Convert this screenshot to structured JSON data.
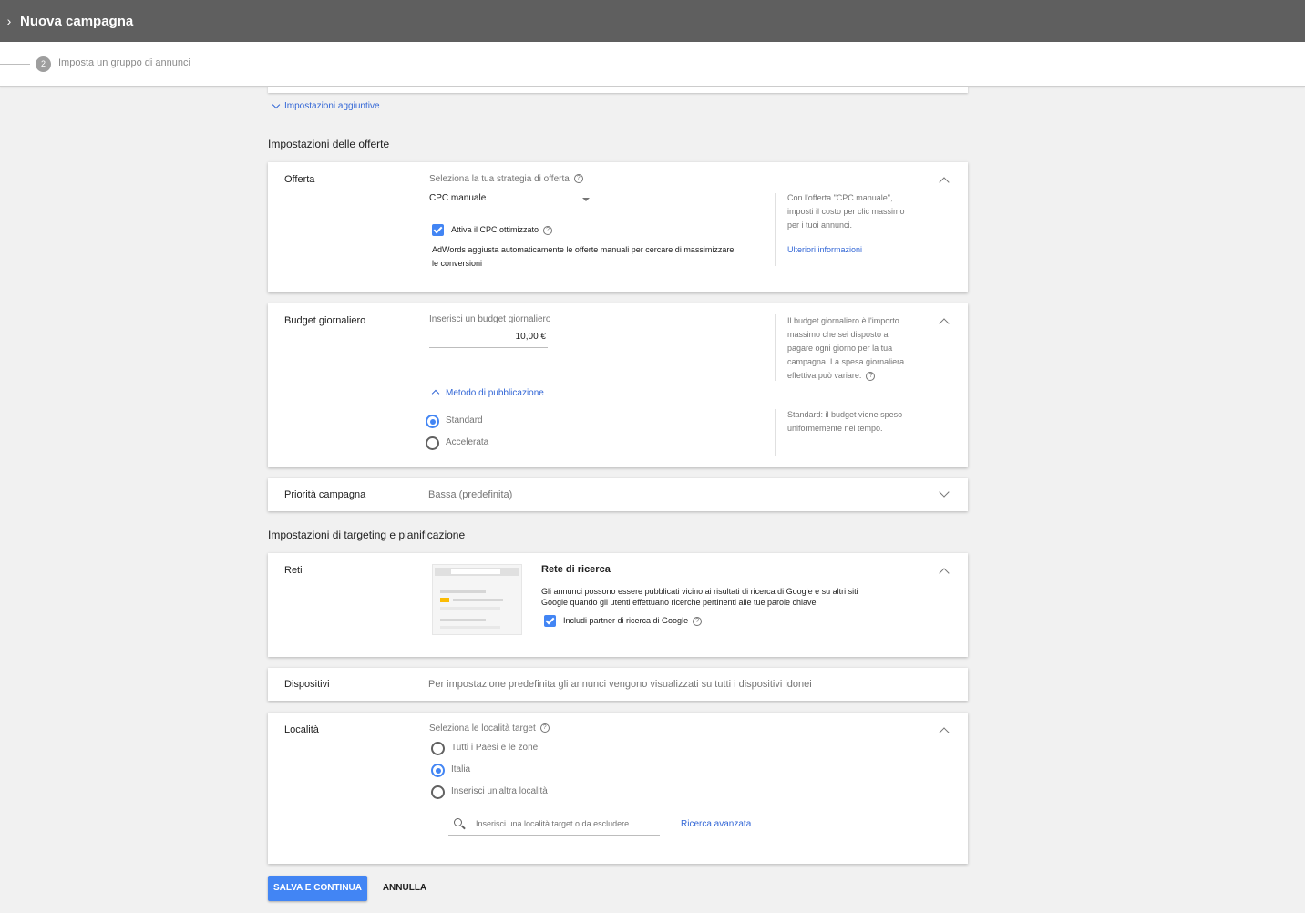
{
  "header": {
    "title": "Nuova campagna"
  },
  "stepper": {
    "step_number": "2",
    "step_label": "Imposta un gruppo di annunci"
  },
  "additional_settings_link": "Impostazioni aggiuntive",
  "bidding_section": {
    "title": "Impostazioni delle offerte"
  },
  "offer_card": {
    "label": "Offerta",
    "strategy_label": "Seleziona la tua strategia di offerta",
    "strategy_value": "CPC manuale",
    "ecpc_label": "Attiva il CPC ottimizzato",
    "ecpc_checked": true,
    "ecpc_description_1": "AdWords aggiusta automaticamente le offerte manuali per cercare di massimizzare",
    "ecpc_description_2": "le conversioni",
    "help_1": "Con l'offerta \"CPC manuale\",",
    "help_2": "imposti il costo per clic massimo",
    "help_3": "per i tuoi annunci.",
    "learn_more": "Ulteriori informazioni"
  },
  "budget_card": {
    "label": "Budget giornaliero",
    "input_label": "Inserisci un budget giornaliero",
    "value": "10,00 €",
    "delivery_link": "Metodo di pubblicazione",
    "options": [
      "Standard",
      "Accelerata"
    ],
    "selected": "Standard",
    "help_1": "Il budget giornaliero è l'importo",
    "help_2": "massimo che sei disposto a",
    "help_3": "pagare ogni giorno per la tua",
    "help_4": "campagna. La spesa giornaliera",
    "help_5": "effettiva può variare.",
    "standard_help_1": "Standard: il budget viene speso",
    "standard_help_2": "uniformemente nel tempo."
  },
  "priority_card": {
    "label": "Priorità campagna",
    "value": "Bassa (predefinita)"
  },
  "targeting_section": {
    "title": "Impostazioni di targeting e pianificazione"
  },
  "networks_card": {
    "label": "Reti",
    "network_title": "Rete di ricerca",
    "description_1": "Gli annunci possono essere pubblicati vicino ai risultati di ricerca di Google e su altri siti",
    "description_2": "Google quando gli utenti effettuano ricerche pertinenti alle tue parole chiave",
    "partners_label": "Includi partner di ricerca di Google",
    "partners_checked": true
  },
  "devices_card": {
    "label": "Dispositivi",
    "value": "Per impostazione predefinita gli annunci vengono visualizzati su tutti i dispositivi idonei"
  },
  "location_card": {
    "label": "Località",
    "select_label": "Seleziona le località target",
    "options": [
      "Tutti i Paesi e le zone",
      "Italia",
      "Inserisci un'altra località"
    ],
    "selected": "Italia",
    "search_placeholder": "Inserisci una località target o da escludere",
    "advanced_search": "Ricerca avanzata"
  },
  "actions": {
    "save": "SALVA E CONTINUA",
    "cancel": "ANNULLA"
  },
  "colors": {
    "accent": "#4285f4",
    "link": "#3367d6",
    "header_bg": "#5f5f5f",
    "page_bg": "#f1f1f1"
  }
}
